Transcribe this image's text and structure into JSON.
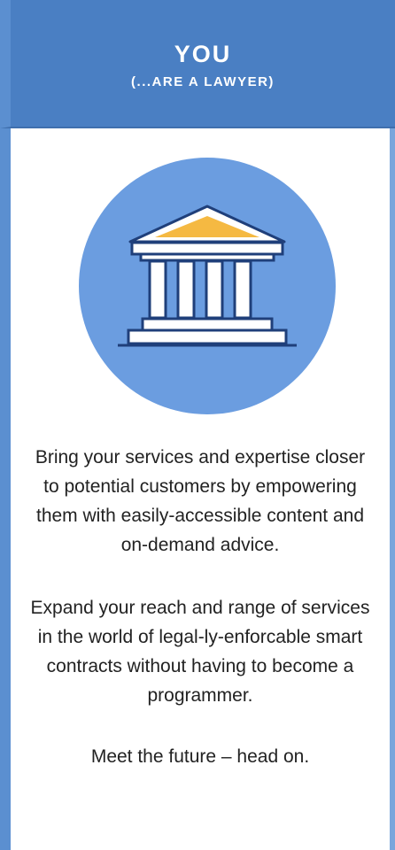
{
  "header": {
    "title": "YOU",
    "subtitle": "(...ARE A LAWYER)"
  },
  "icon": {
    "name": "courthouse-icon",
    "circle_color": "#6b9de0",
    "roof_accent_color": "#f5b942",
    "outline_color": "#1f3f7a"
  },
  "paragraphs": [
    "Bring your services and expertise closer to potential customers by empowering them with easily-accessible content and on-demand advice.",
    "Expand your reach and range of services in the world of legal-ly-enforcable smart contracts without having to become a programmer.",
    "Meet the future – head on."
  ],
  "colors": {
    "header_bg": "#4a7fc3",
    "border": "#5b8fd0"
  }
}
